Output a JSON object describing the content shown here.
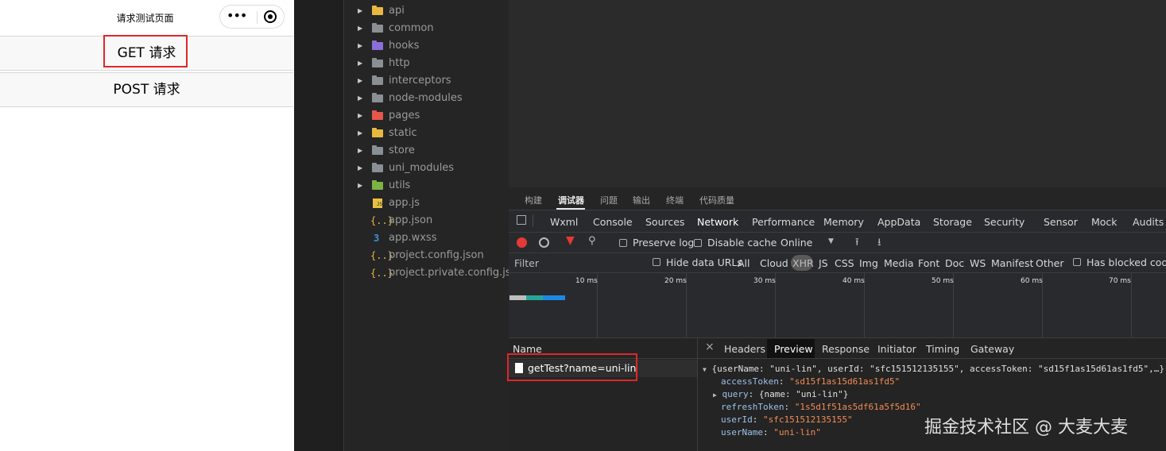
{
  "phone": {
    "title": "请求测试页面",
    "capsule_dots": "•••",
    "buttons": [
      {
        "label": "GET 请求"
      },
      {
        "label": "POST 请求"
      }
    ]
  },
  "explorer": {
    "items": [
      {
        "label": "api",
        "type": "folder",
        "color": "#e8b93f"
      },
      {
        "label": "common",
        "type": "folder",
        "color": "#8a8f94"
      },
      {
        "label": "hooks",
        "type": "folder",
        "color": "#8b6fd8"
      },
      {
        "label": "http",
        "type": "folder",
        "color": "#8a8f94"
      },
      {
        "label": "interceptors",
        "type": "folder",
        "color": "#8a8f94"
      },
      {
        "label": "node-modules",
        "type": "folder",
        "color": "#8a8f94"
      },
      {
        "label": "pages",
        "type": "folder",
        "color": "#e5574a"
      },
      {
        "label": "static",
        "type": "folder",
        "color": "#e8b93f"
      },
      {
        "label": "store",
        "type": "folder",
        "color": "#8a8f94"
      },
      {
        "label": "uni_modules",
        "type": "folder",
        "color": "#8a8f94"
      },
      {
        "label": "utils",
        "type": "folder",
        "color": "#7cb342"
      },
      {
        "label": "app.js",
        "type": "js",
        "glyph": "JS",
        "color": "#e8c23f"
      },
      {
        "label": "app.json",
        "type": "json",
        "glyph": "{..}",
        "color": "#e8b93f"
      },
      {
        "label": "app.wxss",
        "type": "css",
        "glyph": "3",
        "color": "#3d8fe0"
      },
      {
        "label": "project.config.json",
        "type": "json",
        "glyph": "{..}",
        "color": "#e8b93f"
      },
      {
        "label": "project.private.config.json",
        "type": "json",
        "glyph": "{..}",
        "color": "#e8b93f"
      }
    ]
  },
  "panel_tabs": [
    "构建",
    "调试器",
    "问题",
    "输出",
    "终端",
    "代码质量"
  ],
  "devtools": {
    "tabs": [
      "Wxml",
      "Console",
      "Sources",
      "Network",
      "Performance",
      "Memory",
      "AppData",
      "Storage",
      "Security",
      "Sensor",
      "Mock",
      "Audits"
    ],
    "active_tab": "Network",
    "toolbar": {
      "preserve_log": "Preserve log",
      "disable_cache": "Disable cache",
      "throttle": "Online"
    },
    "filter": {
      "label": "Filter",
      "hide_data_urls": "Hide data URLs",
      "types": [
        "All",
        "Cloud",
        "XHR",
        "JS",
        "CSS",
        "Img",
        "Media",
        "Font",
        "Doc",
        "WS",
        "Manifest",
        "Other"
      ],
      "active_type": "XHR",
      "has_blocked": "Has blocked cookie"
    },
    "timeline_ticks": [
      "10 ms",
      "20 ms",
      "30 ms",
      "40 ms",
      "50 ms",
      "60 ms",
      "70 ms"
    ],
    "requests": {
      "header": "Name",
      "rows": [
        "getTest?name=uni-lin"
      ]
    },
    "detail": {
      "close": "×",
      "tabs": [
        "Headers",
        "Preview",
        "Response",
        "Initiator",
        "Timing",
        "Gateway"
      ],
      "active_tab": "Preview",
      "preview": {
        "summary": "{userName: \"uni-lin\", userId: \"sfc151512135155\", accessToken: \"sd15f1as15d61as1fd5\",…}",
        "lines": [
          {
            "key": "accessToken",
            "value": "\"sd15f1as15d61as1fd5\""
          },
          {
            "key": "query",
            "value": "{name: \"uni-lin\"}",
            "expandable": true
          },
          {
            "key": "refreshToken",
            "value": "\"1s5d1f51as5df61a5f5d16\""
          },
          {
            "key": "userId",
            "value": "\"sfc151512135155\""
          },
          {
            "key": "userName",
            "value": "\"uni-lin\""
          }
        ]
      }
    }
  },
  "watermark": "掘金技术社区 @ 大麦大麦",
  "highlight_color": "#e0262b"
}
